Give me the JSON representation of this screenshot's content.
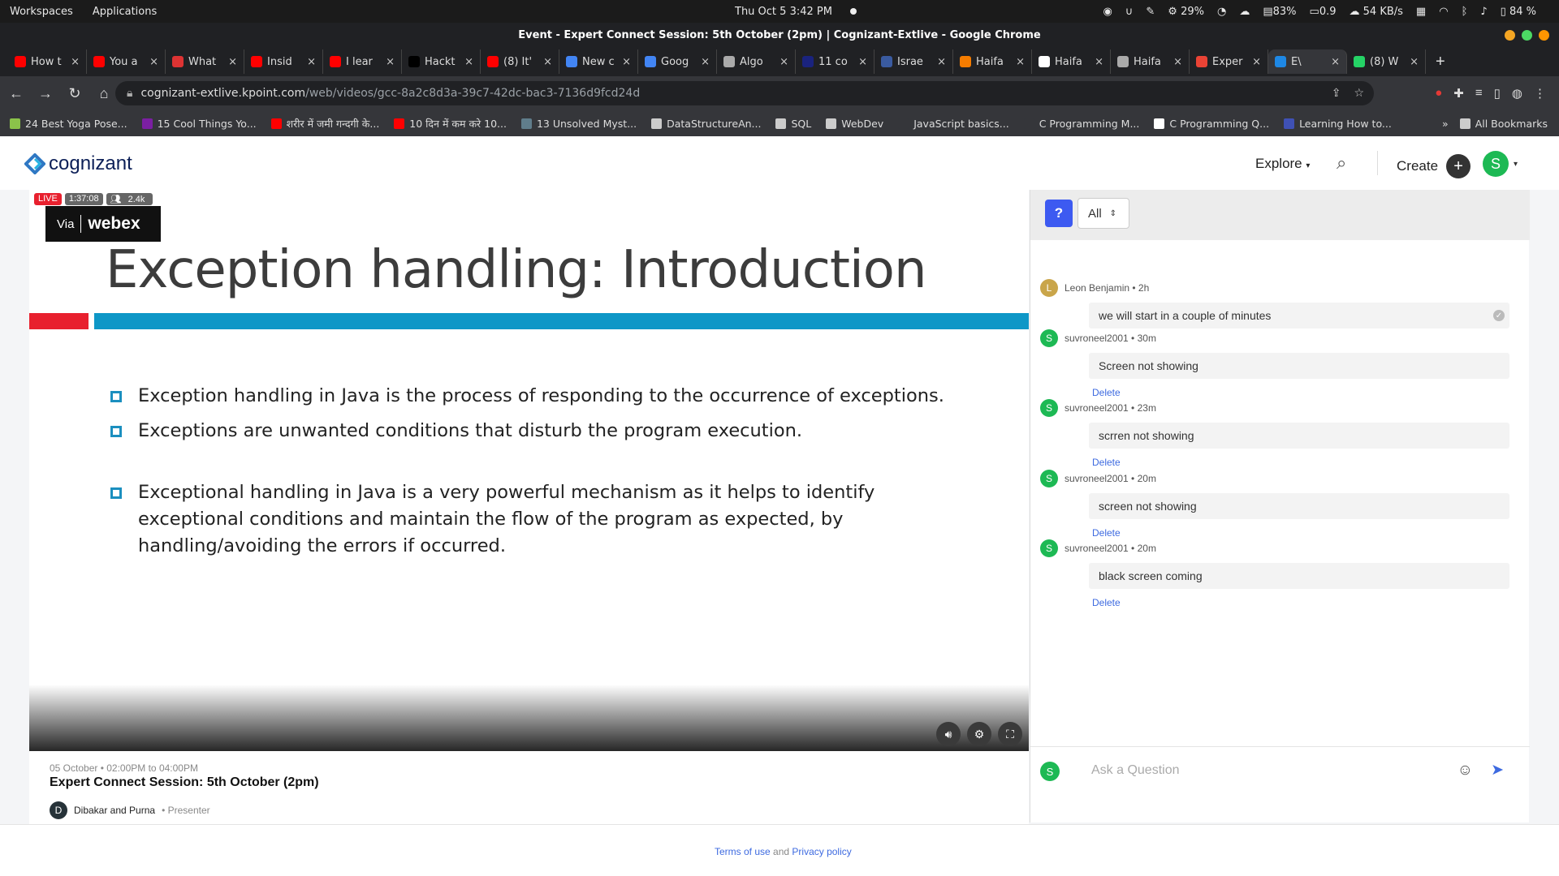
{
  "system_bar": {
    "workspaces": "Workspaces",
    "applications": "Applications",
    "datetime": "Thu Oct 5   3:42 PM",
    "cpu": "29%",
    "mem": "83%",
    "load": "0.9",
    "net": "54 KB/s",
    "battery": "84 %"
  },
  "window_title": "Event - Expert Connect Session: 5th October (2pm) | Cognizant-Extlive - Google Chrome",
  "tabs": [
    {
      "label": "How t",
      "color": "#ff0000"
    },
    {
      "label": "You a",
      "color": "#ff0000"
    },
    {
      "label": "What",
      "color": "#d33"
    },
    {
      "label": "Insid",
      "color": "#ff0000"
    },
    {
      "label": "I lear",
      "color": "#ff0000"
    },
    {
      "label": "Hackt",
      "color": "#000000"
    },
    {
      "label": "(8) It'",
      "color": "#ff0000"
    },
    {
      "label": "New c",
      "color": "#4285f4"
    },
    {
      "label": "Goog",
      "color": "#4285f4"
    },
    {
      "label": "Algo",
      "color": "#aaaaaa"
    },
    {
      "label": "11 co",
      "color": "#1a237e"
    },
    {
      "label": "Israe",
      "color": "#3a5ba0"
    },
    {
      "label": "Haifa",
      "color": "#f57c00"
    },
    {
      "label": "Haifa",
      "color": "#ffffff"
    },
    {
      "label": "Haifa",
      "color": "#aaaaaa"
    },
    {
      "label": "Exper",
      "color": "#ea4335"
    },
    {
      "label": "E\\",
      "color": "#1e88e5"
    },
    {
      "label": "(8) W",
      "color": "#25d366"
    }
  ],
  "url": {
    "host": "cognizant-extlive.kpoint.com",
    "path": "/web/videos/gcc-8a2c8d3a-39c7-42dc-bac3-7136d9fcd24d"
  },
  "bookmarks": [
    {
      "label": "24 Best Yoga Pose...",
      "color": "#8bc34a"
    },
    {
      "label": "15 Cool Things Yo...",
      "color": "#7b1fa2"
    },
    {
      "label": "शरीर में जमी गन्दगी के...",
      "color": "#ff0000"
    },
    {
      "label": "10 दिन में कम करे 10...",
      "color": "#ff0000"
    },
    {
      "label": "13 Unsolved Myst...",
      "color": "#607d8b"
    },
    {
      "label": "DataStructureAn...",
      "color": "#cccccc"
    },
    {
      "label": "SQL",
      "color": "#cccccc"
    },
    {
      "label": "WebDev",
      "color": "#cccccc"
    },
    {
      "label": "JavaScript basics...",
      "color": "#35363a"
    },
    {
      "label": "C Programming M...",
      "color": "#35363a"
    },
    {
      "label": "C Programming Q...",
      "color": "#ffffff"
    },
    {
      "label": "Learning How to...",
      "color": "#3f51b5"
    }
  ],
  "all_bookmarks": "All Bookmarks",
  "app_header": {
    "logo": "cognizant",
    "explore": "Explore",
    "create": "Create",
    "user_initial": "S"
  },
  "video": {
    "live": "LIVE",
    "duration": "1:37:08",
    "viewers": "2.4k",
    "via": "Via",
    "webex": "webex",
    "slide_title": "Exception handling: Introduction",
    "bullets": [
      "Exception handling in Java is the process of responding to the occurrence of exceptions.",
      "Exceptions are unwanted conditions that disturb the program execution.",
      "Exceptional handling in Java is a very powerful mechanism as it helps to identify exceptional conditions and maintain the flow of the program as expected, by handling/avoiding the errors if occurred."
    ]
  },
  "event": {
    "date": "05 October • 02:00PM to 04:00PM",
    "title": "Expert Connect Session: 5th October (2pm)",
    "presenter_initial": "D",
    "presenter": "Dibakar and Purna",
    "presenter_role": "• Presenter"
  },
  "qa": {
    "filter": "All",
    "messages": [
      {
        "initial": "L",
        "author": "Leon Benjamin • 2h",
        "text": "we will start in a couple of minutes",
        "color": "#c9a54a",
        "delete": ""
      },
      {
        "initial": "S",
        "author": "suvroneel2001 • 30m",
        "text": "Screen not showing",
        "color": "#1db954",
        "delete": "Delete"
      },
      {
        "initial": "S",
        "author": "suvroneel2001 • 23m",
        "text": "scrren not showing",
        "color": "#1db954",
        "delete": "Delete"
      },
      {
        "initial": "S",
        "author": "suvroneel2001 • 20m",
        "text": "screen not showing",
        "color": "#1db954",
        "delete": "Delete"
      },
      {
        "initial": "S",
        "author": "suvroneel2001 • 20m",
        "text": "black screen coming",
        "color": "#1db954",
        "delete": "Delete"
      }
    ],
    "ask_placeholder": "Ask a Question",
    "user_initial": "S"
  },
  "footer": {
    "terms": "Terms of use",
    "and": " and ",
    "privacy": "Privacy policy"
  }
}
